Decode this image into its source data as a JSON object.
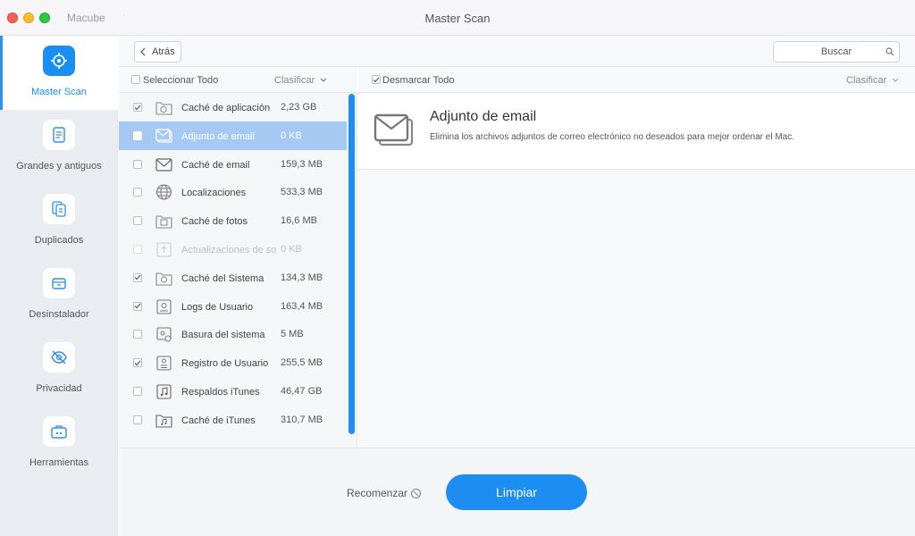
{
  "window": {
    "app_name": "Macube",
    "title": "Master Scan"
  },
  "sidebar": {
    "items": [
      {
        "label": "Master Scan",
        "icon": "target-icon",
        "active": true
      },
      {
        "label": "Grandes y antiguos",
        "icon": "document-icon"
      },
      {
        "label": "Duplicados",
        "icon": "duplicate-icon"
      },
      {
        "label": "Desinstalador",
        "icon": "box-icon"
      },
      {
        "label": "Privacidad",
        "icon": "eye-slash-icon"
      },
      {
        "label": "Herramientas",
        "icon": "toolbox-icon"
      }
    ]
  },
  "toolbar": {
    "back_label": "Atrás",
    "search_placeholder": "Buscar"
  },
  "list": {
    "select_all_label": "Seleccionar Todo",
    "sort_label": "Clasificar",
    "rows": [
      {
        "name": "Caché de aplicación",
        "size": "2,23 GB",
        "checked": true,
        "icon": "app-cache-icon"
      },
      {
        "name": "Adjunto de email",
        "size": "0 KB",
        "checked": false,
        "selected": true,
        "icon": "mail-attachment-icon"
      },
      {
        "name": "Caché de email",
        "size": "159,3 MB",
        "checked": false,
        "icon": "mail-icon"
      },
      {
        "name": "Localizaciones",
        "size": "533,3 MB",
        "checked": false,
        "icon": "globe-icon"
      },
      {
        "name": "Caché de fotos",
        "size": "16,6 MB",
        "checked": false,
        "icon": "photo-cache-icon"
      },
      {
        "name": "Actualizaciones de so",
        "size": "0 KB",
        "checked": false,
        "disabled": true,
        "icon": "update-icon"
      },
      {
        "name": "Caché del Sistema",
        "size": "134,3 MB",
        "checked": true,
        "icon": "system-cache-icon"
      },
      {
        "name": "Logs de Usuario",
        "size": "163,4 MB",
        "checked": true,
        "icon": "user-logs-icon"
      },
      {
        "name": "Basura del sistema",
        "size": "5 MB",
        "checked": false,
        "icon": "system-junk-icon"
      },
      {
        "name": "Registro de Usuario",
        "size": "255,5 MB",
        "checked": true,
        "icon": "user-record-icon"
      },
      {
        "name": "Respaldos iTunes",
        "size": "46,47 GB",
        "checked": false,
        "icon": "itunes-backup-icon"
      },
      {
        "name": "Caché de iTunes",
        "size": "310,7 MB",
        "checked": false,
        "icon": "itunes-cache-icon"
      }
    ]
  },
  "detail": {
    "deselect_all_label": "Desmarcar Todo",
    "sort_label": "Clasificar",
    "title": "Adjunto de email",
    "description": "Elimina los archivos adjuntos de correo electrónico no deseados para mejor ordenar el Mac."
  },
  "footer": {
    "restart_label": "Recomenzar",
    "clean_label": "Limpiar"
  },
  "colors": {
    "accent": "#1d8df2",
    "selection": "#a5c9f2"
  }
}
